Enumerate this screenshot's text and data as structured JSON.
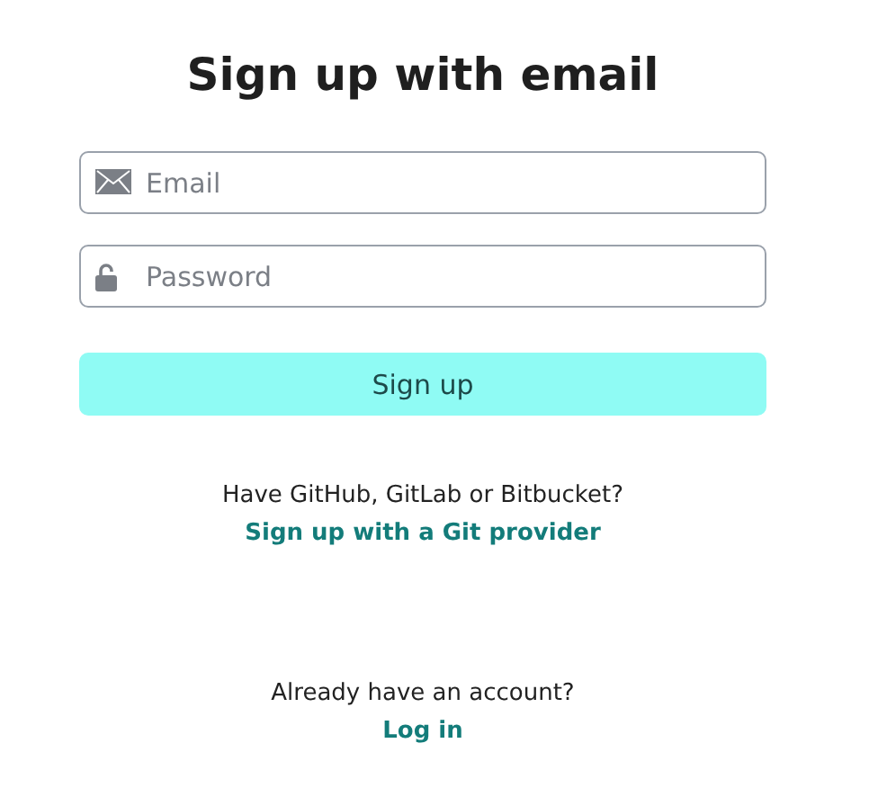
{
  "title": "Sign up with email",
  "fields": [
    {
      "kind": "email",
      "placeholder": "Email"
    },
    {
      "kind": "password",
      "placeholder": "Password"
    }
  ],
  "submit": {
    "label": "Sign up"
  },
  "providers": {
    "prompt": "Have GitHub, GitLab or Bitbucket?",
    "link": "Sign up with a Git provider"
  },
  "login": {
    "prompt": "Already have an account?",
    "link": "Log in"
  }
}
